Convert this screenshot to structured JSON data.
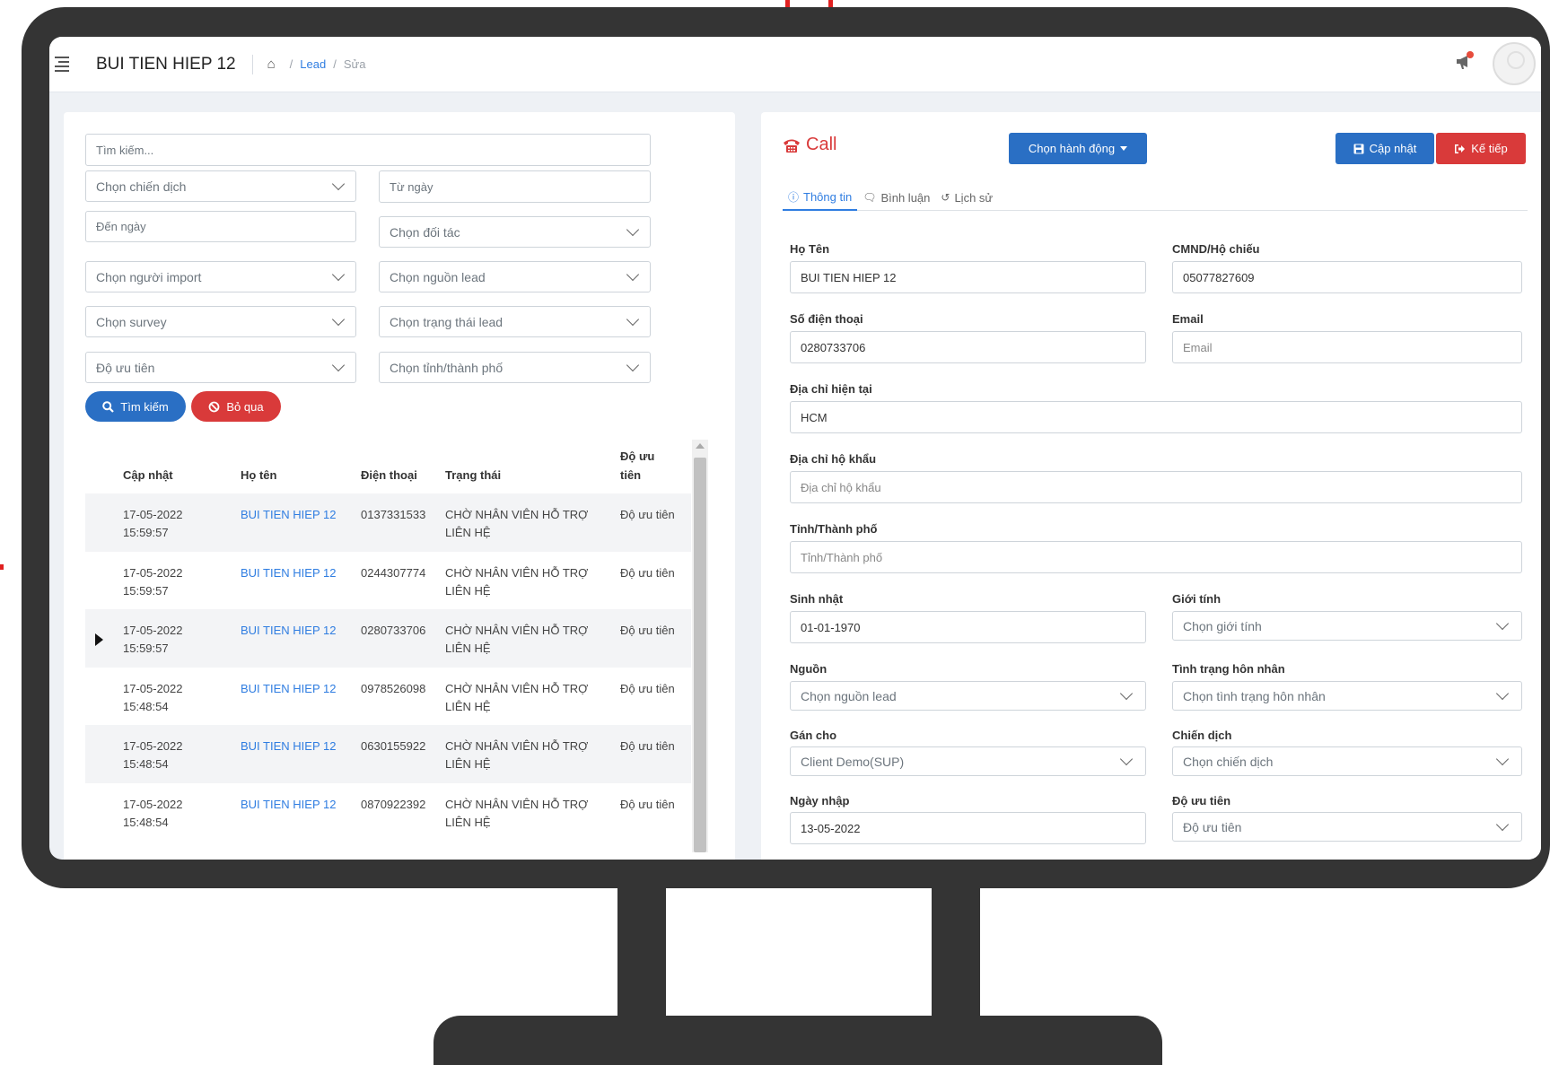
{
  "header": {
    "title": "BUI TIEN HIEP 12",
    "breadcrumb": {
      "sep1": "/",
      "lead": "Lead",
      "sep2": "/",
      "current": "Sửa"
    }
  },
  "filters": {
    "search_placeholder": "Tìm kiếm...",
    "campaign": "Chọn chiến dịch",
    "from_date": "Từ ngày",
    "to_date": "Đến ngày",
    "partner": "Chọn đối tác",
    "importer": "Chọn người import",
    "lead_source": "Chọn nguồn lead",
    "survey": "Chọn survey",
    "lead_status": "Chọn trạng thái lead",
    "priority": "Độ ưu tiên",
    "province": "Chọn tỉnh/thành phố",
    "search_button": "Tìm kiếm",
    "reset_button": "Bỏ qua"
  },
  "table": {
    "columns": {
      "updated": "Cập nhật",
      "name": "Họ tên",
      "phone": "Điện thoại",
      "status": "Trạng thái",
      "priority_1": "Độ ưu",
      "priority_2": "tiên"
    },
    "rows": [
      {
        "date": "17-05-2022",
        "time": "15:59:57",
        "name": "BUI TIEN HIEP 12",
        "phone": "0137331533",
        "status_1": "CHỜ NHÂN VIÊN HỖ TRỢ",
        "status_2": "LIÊN HỆ",
        "priority": "Độ ưu tiên"
      },
      {
        "date": "17-05-2022",
        "time": "15:59:57",
        "name": "BUI TIEN HIEP 12",
        "phone": "0244307774",
        "status_1": "CHỜ NHÂN VIÊN HỖ TRỢ",
        "status_2": "LIÊN HỆ",
        "priority": "Độ ưu tiên"
      },
      {
        "date": "17-05-2022",
        "time": "15:59:57",
        "name": "BUI TIEN HIEP 12",
        "phone": "0280733706",
        "status_1": "CHỜ NHÂN VIÊN HỖ TRỢ",
        "status_2": "LIÊN HỆ",
        "priority": "Độ ưu tiên"
      },
      {
        "date": "17-05-2022",
        "time": "15:48:54",
        "name": "BUI TIEN HIEP 12",
        "phone": "0978526098",
        "status_1": "CHỜ NHÂN VIÊN HỖ TRỢ",
        "status_2": "LIÊN HỆ",
        "priority": "Độ ưu tiên"
      },
      {
        "date": "17-05-2022",
        "time": "15:48:54",
        "name": "BUI TIEN HIEP 12",
        "phone": "0630155922",
        "status_1": "CHỜ NHÂN VIÊN HỖ TRỢ",
        "status_2": "LIÊN HỆ",
        "priority": "Độ ưu tiên"
      },
      {
        "date": "17-05-2022",
        "time": "15:48:54",
        "name": "BUI TIEN HIEP 12",
        "phone": "0870922392",
        "status_1": "CHỜ NHÂN VIÊN HỖ TRỢ",
        "status_2": "LIÊN HỆ",
        "priority": "Độ ưu tiên"
      }
    ],
    "selected_row": 2
  },
  "detail": {
    "title": "Call",
    "action_button": "Chọn hành động",
    "update_button": "Cập nhật",
    "next_button": "Kế tiếp",
    "tabs": {
      "info": "Thông tin",
      "comment": "Bình luận",
      "history": "Lịch sử"
    },
    "fields": {
      "fullname_label": "Họ Tên",
      "fullname_value": "BUI TIEN HIEP 12",
      "idcard_label": "CMND/Hộ chiếu",
      "idcard_value": "05077827609",
      "phone_label": "Số điện thoại",
      "phone_value": "0280733706",
      "email_label": "Email",
      "email_placeholder": "Email",
      "address_label": "Địa chỉ hiện tại",
      "address_value": "HCM",
      "household_label": "Địa chỉ hộ khẩu",
      "household_placeholder": "Địa chỉ hộ khẩu",
      "province_label": "Tỉnh/Thành phố",
      "province_placeholder": "Tỉnh/Thành phố",
      "birthday_label": "Sinh nhật",
      "birthday_value": "01-01-1970",
      "gender_label": "Giới tính",
      "gender_value": "Chọn giới tính",
      "source_label": "Nguồn",
      "source_value": "Chọn nguồn lead",
      "marital_label": "Tình trạng hôn nhân",
      "marital_value": "Chọn tình trạng hôn nhân",
      "assign_label": "Gán cho",
      "assign_value": "Client Demo(SUP)",
      "campaign_label": "Chiến dịch",
      "campaign_value": "Chọn chiến dịch",
      "import_date_label": "Ngày nhập",
      "import_date_value": "13-05-2022",
      "priority_label": "Độ ưu tiên",
      "priority_value": "Độ ưu tiên"
    }
  },
  "colors": {
    "primary": "#2a6fc4",
    "danger": "#d93a3a",
    "link": "#2f7de1",
    "annotation": "#e02020",
    "monitor": "#343434"
  }
}
